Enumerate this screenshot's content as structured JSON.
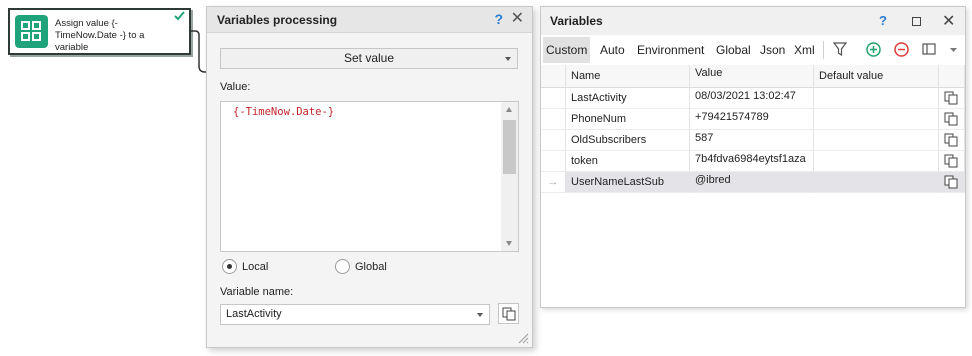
{
  "action_block": {
    "text": "Assign value {-TimeNow.Date -} to a variable",
    "icon": "grid-squares-icon",
    "status_icon": "checkmark-icon",
    "accent_color": "#1fa37a"
  },
  "vars_processing": {
    "title": "Variables processing",
    "help_label": "?",
    "close_label": "✕",
    "mode": "Set value",
    "value_label": "Value:",
    "value_text": "{-TimeNow.Date-}",
    "scope_local": "Local",
    "scope_global": "Global",
    "scope_selected": "Local",
    "variable_name_label": "Variable name:",
    "variable_name": "LastActivity"
  },
  "variables_window": {
    "title": "Variables",
    "help_label": "?",
    "close_label": "✕",
    "tabs": [
      {
        "label": "Custom",
        "active": true
      },
      {
        "label": "Auto",
        "active": false
      },
      {
        "label": "Environment",
        "active": false
      },
      {
        "label": "Global",
        "active": false
      },
      {
        "label": "Json",
        "active": false
      },
      {
        "label": "Xml",
        "active": false
      }
    ],
    "toolbar_icons": [
      "filter-icon",
      "add-icon",
      "remove-icon",
      "columns-icon",
      "chevron-down-icon"
    ],
    "columns": {
      "name": "Name",
      "value": "Value",
      "default": "Default value"
    },
    "rows": [
      {
        "name": "LastActivity",
        "value": "08/03/2021 13:02:47",
        "default": ""
      },
      {
        "name": "PhoneNum",
        "value": "+79421574789",
        "default": ""
      },
      {
        "name": "OldSubscribers",
        "value": "587",
        "default": ""
      },
      {
        "name": "token",
        "value": "7b4fdva6984eytsf1aza",
        "default": ""
      },
      {
        "name": "UserNameLastSub",
        "value": "@ibred",
        "default": "",
        "selected": true,
        "indicator": "→"
      }
    ],
    "colors": {
      "add": "#1fa36a",
      "remove": "#e03a3a"
    }
  }
}
